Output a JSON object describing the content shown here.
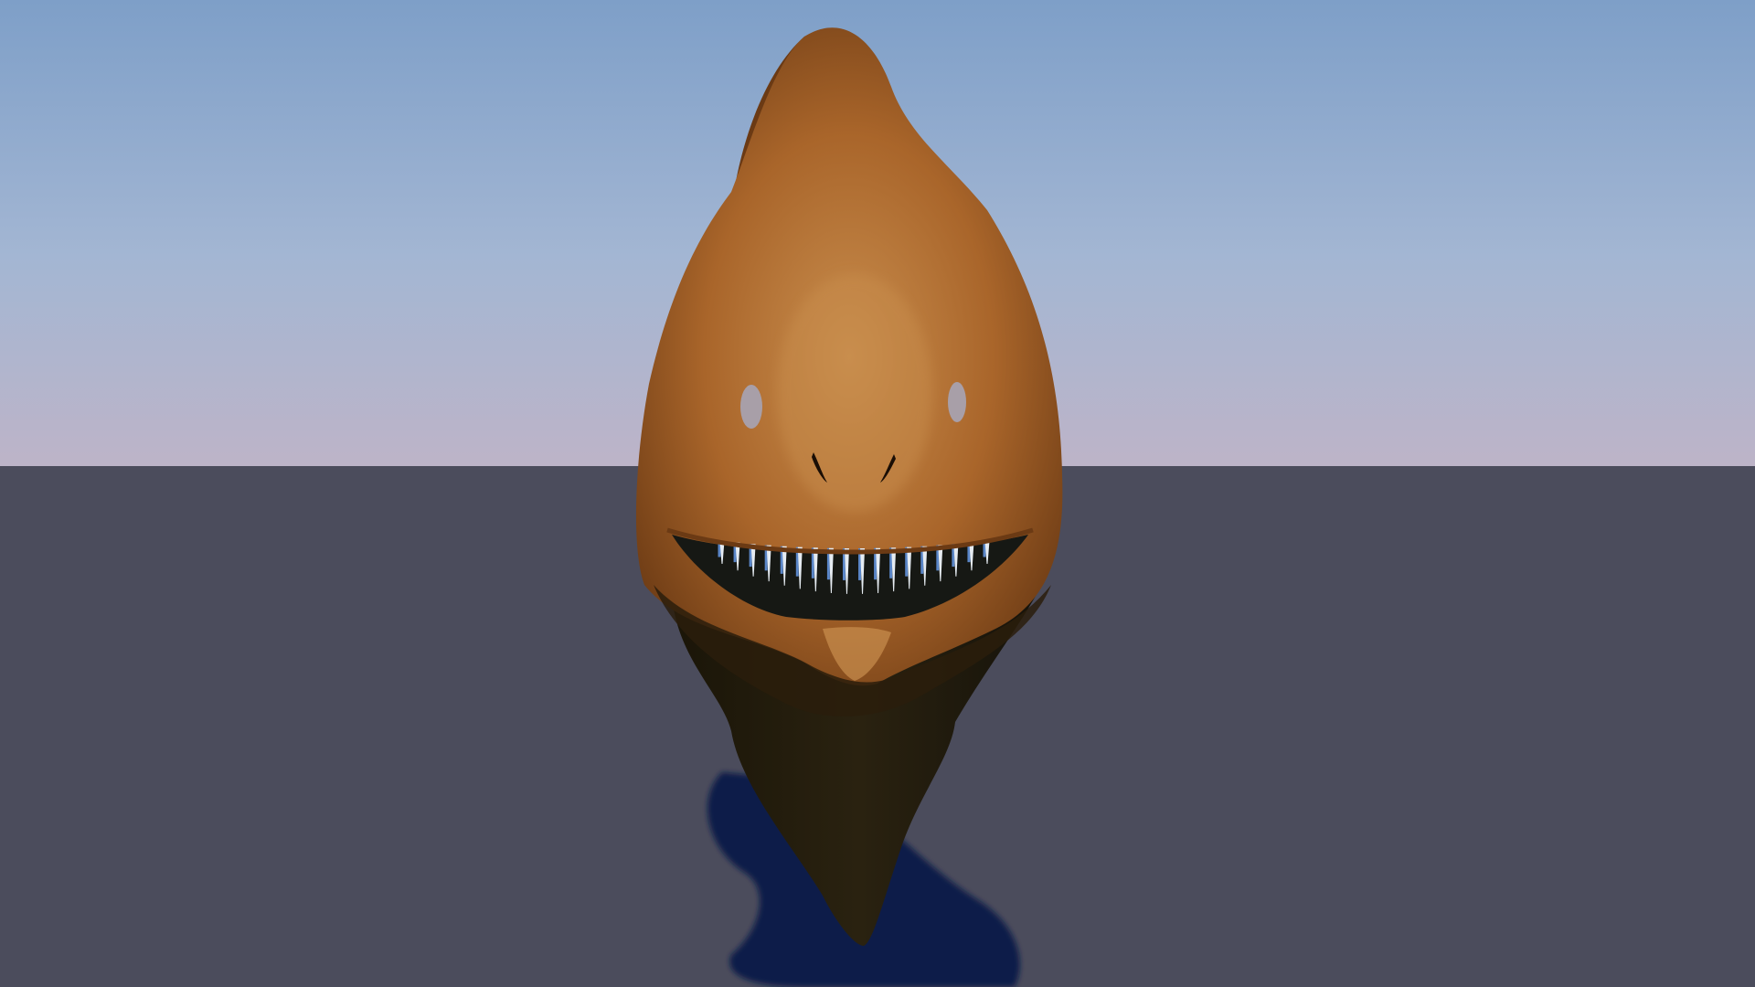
{
  "scene": {
    "subject": "creature-head-render",
    "colors": {
      "sky_top": "#7e9fc8",
      "sky_mid": "#a3b6d3",
      "sky_horizon": "#bdb4c8",
      "ground": "#4b4c5c",
      "skin": "#a9652a",
      "skin_light": "#c98e4e",
      "skin_dark": "#6b3a14",
      "mouth": "#161814",
      "teeth": "#e6ecf2",
      "teeth_glow": "#5a86c8",
      "shadow": "#0a1c4a",
      "eye": "#a89fa8"
    }
  }
}
